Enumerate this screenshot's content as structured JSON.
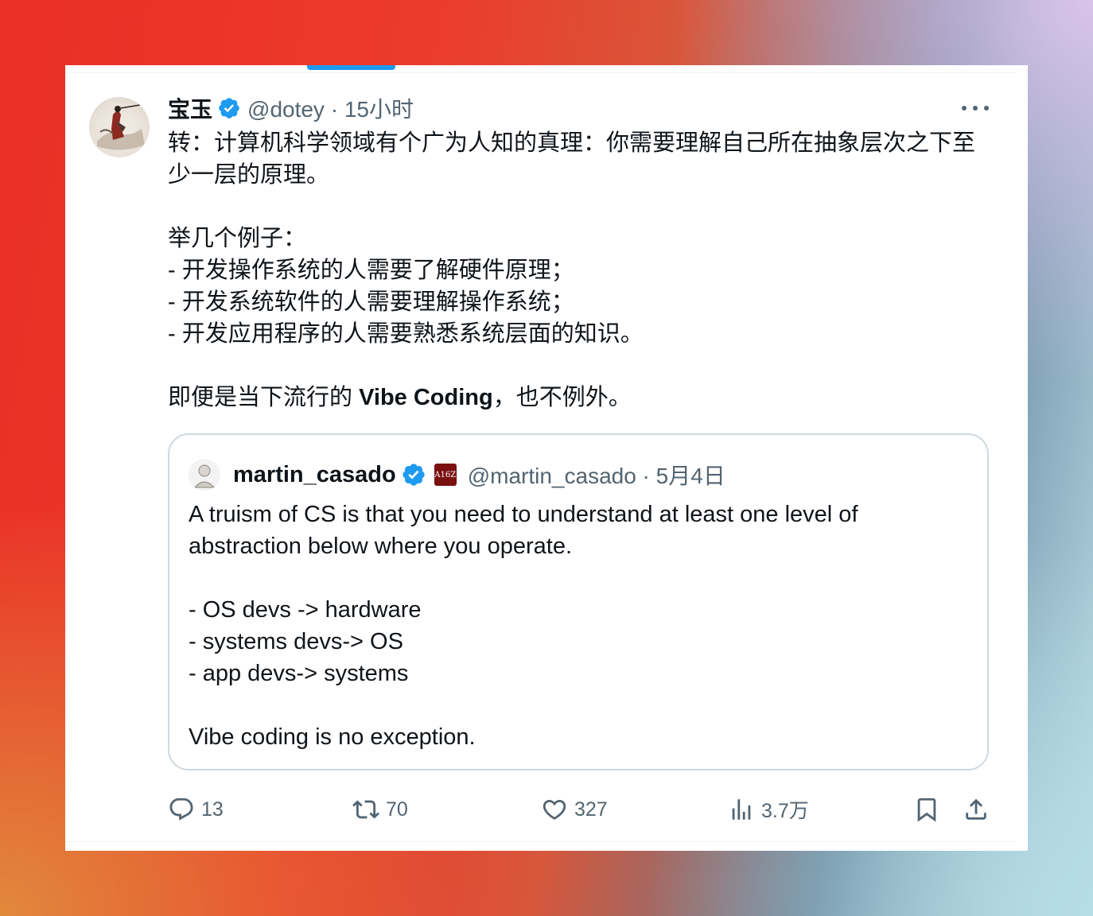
{
  "tweet": {
    "author_name": "宝玉",
    "author_handle": "@dotey",
    "time": "15小时",
    "paragraphs": [
      {
        "text": "转：计算机科学领域有个广为人知的真理：你需要理解自己所在抽象层次之下至少一层的原理。"
      },
      {
        "text": "举几个例子："
      },
      {
        "text": "- 开发操作系统的人需要了解硬件原理；"
      },
      {
        "text": "- 开发系统软件的人需要理解操作系统；"
      },
      {
        "text": "- 开发应用程序的人需要熟悉系统层面的知识。"
      },
      {
        "pre": "即便是当下流行的 ",
        "bold": "Vibe Coding",
        "post": "，也不例外。"
      }
    ]
  },
  "quoted": {
    "author_name": "martin_casado",
    "badge_text": "A16Z",
    "author_handle": "@martin_casado",
    "date": "5月4日",
    "lines": [
      "A truism of CS is that you need to understand at least one level of abstraction below where you operate.",
      "- OS devs -> hardware",
      "- systems devs-> OS",
      "- app devs-> systems",
      "Vibe coding is no exception."
    ]
  },
  "actions": {
    "replies": "13",
    "retweets": "70",
    "likes": "327",
    "views": "3.7万"
  },
  "colors": {
    "accent": "#1d9bf0",
    "text": "#0f1419",
    "secondary": "#536471",
    "border": "#cfd9de"
  },
  "icons": [
    "verified-icon",
    "more-icon",
    "reply-icon",
    "retweet-icon",
    "like-icon",
    "views-icon",
    "bookmark-icon",
    "share-icon"
  ]
}
